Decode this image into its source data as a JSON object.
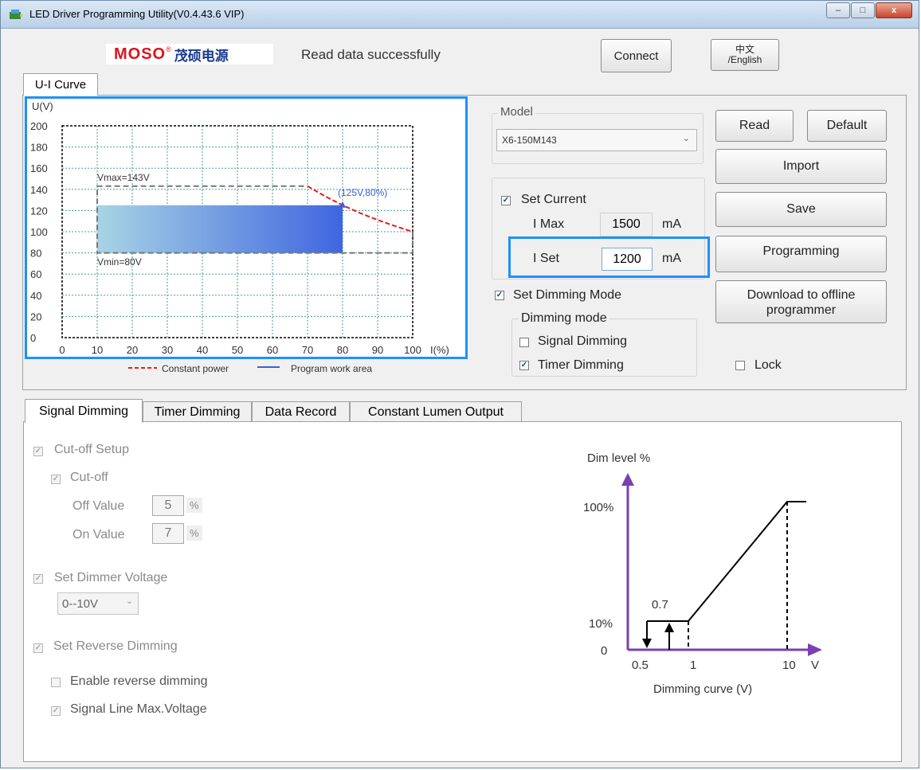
{
  "window": {
    "title": "LED Driver Programming Utility(V0.4.43.6 VIP)",
    "controls": {
      "minimize": "–",
      "maximize": "□",
      "close": "x"
    }
  },
  "header": {
    "logo_brand": "MOSO",
    "logo_chinese": "茂硕电源",
    "status": "Read data successfully",
    "connect_label": "Connect",
    "language_label_line1": "中文",
    "language_label_line2": "/English"
  },
  "top_tab": {
    "label": "U-I Curve"
  },
  "chart_data": {
    "type": "area",
    "y_unit_label": "U(V)",
    "x_unit_label": "I(%)",
    "xlim": [
      0,
      100
    ],
    "ylim": [
      0,
      200
    ],
    "x_ticks": [
      "0",
      "10",
      "20",
      "30",
      "40",
      "50",
      "60",
      "70",
      "80",
      "90",
      "100"
    ],
    "y_ticks": [
      "200",
      "180",
      "160",
      "140",
      "120",
      "100",
      "80",
      "60",
      "40",
      "20",
      "0"
    ],
    "annotations": {
      "vmax": "Vmax=143V",
      "vmin": "Vmin=80V",
      "point": "(125V,80%)"
    },
    "envelope_box": {
      "x": [
        10,
        100
      ],
      "y": [
        80,
        143
      ]
    },
    "program_work_area": {
      "x": [
        10,
        80
      ],
      "y": [
        80,
        125
      ]
    },
    "constant_power": {
      "x": [
        70,
        75,
        80,
        85,
        90,
        95,
        100
      ],
      "y": [
        143,
        133.5,
        125,
        117.6,
        111.1,
        105.3,
        100
      ]
    },
    "legend": {
      "constant_power": "Constant power",
      "program_work_area": "Program work area"
    },
    "colors": {
      "constant_power": "#e41e1e",
      "work_area_start": "#a8d4e4",
      "work_area_end": "#3f66e0",
      "legend_work_area": "#3b5fd6",
      "grid": "#4a9a9a",
      "highlight": "#1e90ff"
    }
  },
  "model": {
    "label": "Model",
    "value": "X6-150M143"
  },
  "buttons": {
    "read": "Read",
    "default": "Default",
    "import": "Import",
    "save": "Save",
    "programming": "Programming",
    "download_line1": "Download to offline",
    "download_line2": "programmer"
  },
  "current": {
    "set_current_label": "Set Current",
    "imax_label": "I Max",
    "imax_value": "1500",
    "unit": "mA",
    "iset_label": "I Set",
    "iset_value": "1200"
  },
  "dimming": {
    "set_dimming_mode": "Set Dimming Mode",
    "group_label": "Dimming mode",
    "signal": "Signal Dimming",
    "timer": "Timer Dimming",
    "lock": "Lock"
  },
  "bottom_tabs": [
    "Signal Dimming",
    "Timer Dimming",
    "Data Record",
    "Constant Lumen Output"
  ],
  "signal_panel": {
    "cutoff_setup": "Cut-off Setup",
    "cutoff": "Cut-off",
    "off_value_label": "Off Value",
    "off_value": "5",
    "on_value_label": "On Value",
    "on_value": "7",
    "percent": "%",
    "set_dimmer_voltage": "Set Dimmer Voltage",
    "voltage_option": "0--10V",
    "set_reverse_dimming": "Set Reverse Dimming",
    "enable_reverse": "Enable reverse dimming",
    "signal_max_voltage": "Signal Line Max.Voltage"
  },
  "dim_curve": {
    "y_title": "Dim level %",
    "y100": "100%",
    "y10": "10%",
    "y0": "0",
    "label_07": "0.7",
    "x05": "0.5",
    "x1": "1",
    "x10": "10",
    "xv": "V",
    "caption": "Dimming curve (V)",
    "colors": {
      "axis": "#7b3fb3",
      "line": "#000000"
    }
  }
}
